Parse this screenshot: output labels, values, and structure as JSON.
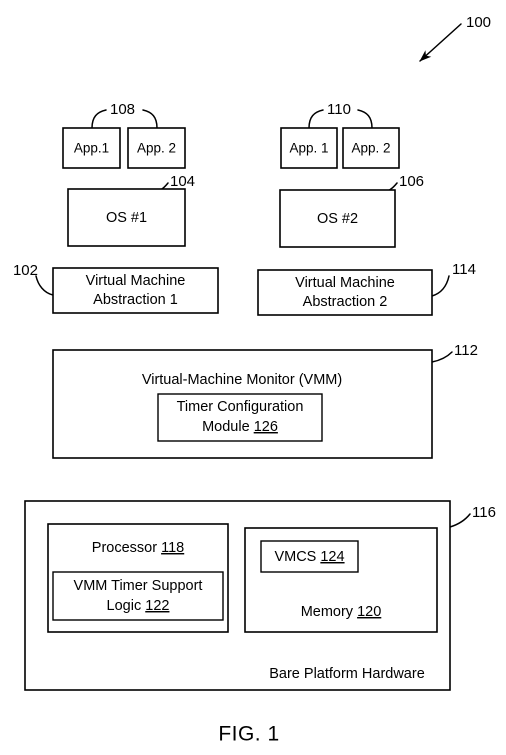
{
  "figure": {
    "caption": "FIG. 1",
    "system_ref": "100"
  },
  "apps": {
    "left": {
      "group_ref": "108",
      "items": [
        {
          "label": "App.1"
        },
        {
          "label": "App. 2"
        }
      ]
    },
    "right": {
      "group_ref": "110",
      "items": [
        {
          "label": "App. 1"
        },
        {
          "label": "App. 2"
        }
      ]
    }
  },
  "operating_systems": [
    {
      "label": "OS #1",
      "ref": "104"
    },
    {
      "label": "OS #2",
      "ref": "106"
    }
  ],
  "vm_abstractions": [
    {
      "line1": "Virtual Machine",
      "line2": "Abstraction 1",
      "ref": "102"
    },
    {
      "line1": "Virtual Machine",
      "line2": "Abstraction 2",
      "ref": "114"
    }
  ],
  "vmm": {
    "title": "Virtual-Machine Monitor (VMM)",
    "ref": "112",
    "module": {
      "line1": "Timer Configuration",
      "line2_text": "Module ",
      "line2_ref": "126"
    }
  },
  "hardware": {
    "label": "Bare Platform Hardware",
    "ref": "116",
    "processor": {
      "label_text": "Processor ",
      "label_ref": "118",
      "logic": {
        "line1": "VMM Timer Support",
        "line2_text": "Logic ",
        "line2_ref": "122"
      }
    },
    "memory": {
      "label_text": "Memory  ",
      "label_ref": "120",
      "vmcs": {
        "label_text": "VMCS ",
        "label_ref": "124"
      }
    }
  },
  "colors": {
    "stroke": "#000000",
    "fill": "#ffffff"
  }
}
